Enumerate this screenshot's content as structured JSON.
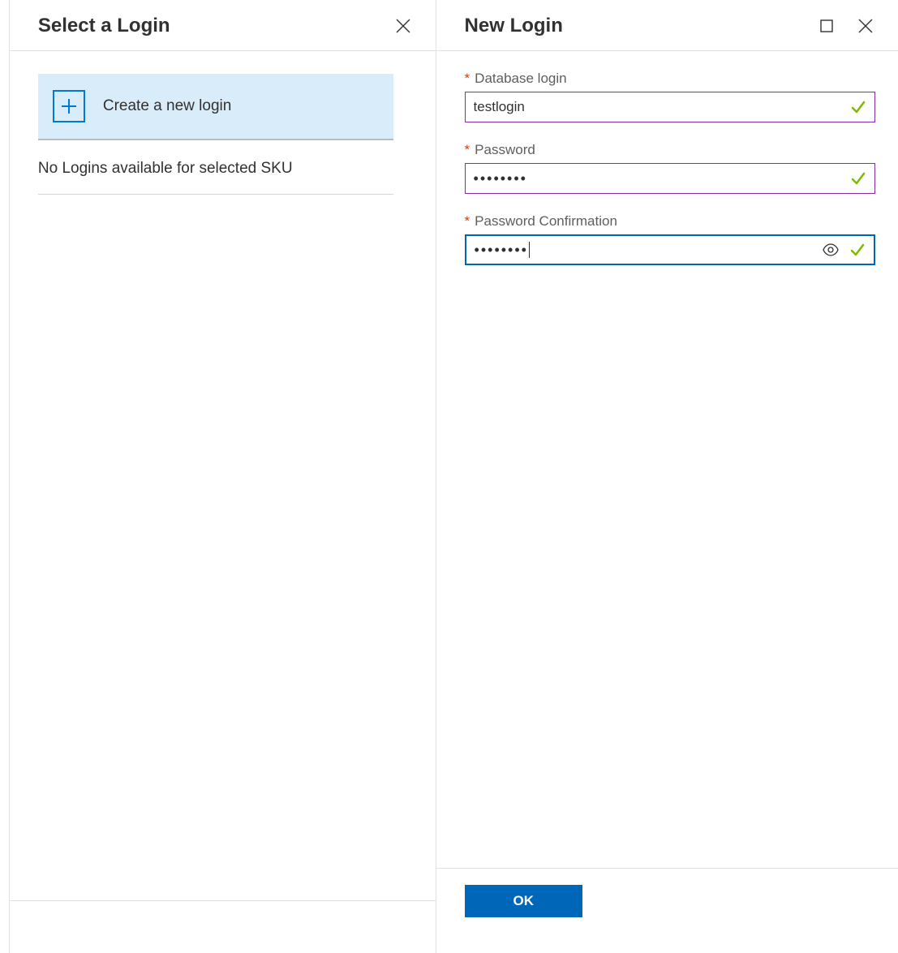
{
  "left": {
    "title": "Select a Login",
    "create_card": "Create a new login",
    "empty": "No Logins available for selected SKU"
  },
  "right": {
    "title": "New Login",
    "fields": {
      "login": {
        "label": "Database login",
        "value": "testlogin"
      },
      "password": {
        "label": "Password",
        "value": "••••••••"
      },
      "confirm": {
        "label": "Password Confirmation",
        "value": "••••••••"
      }
    },
    "ok": "OK"
  },
  "symbols": {
    "required": "*"
  }
}
